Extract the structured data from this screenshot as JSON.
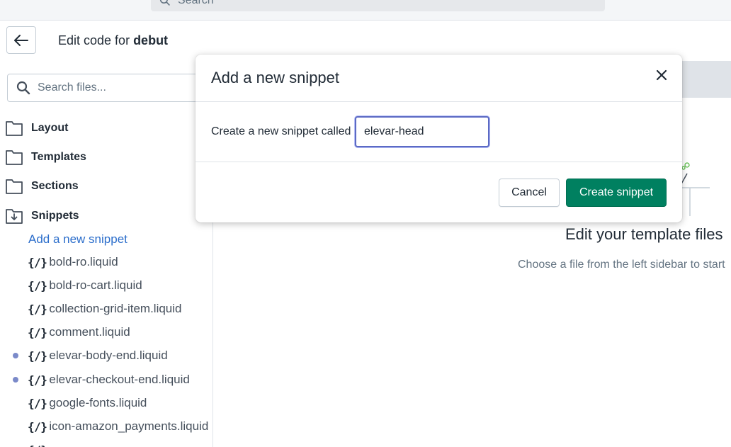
{
  "topbar": {
    "search_placeholder": "Search"
  },
  "header": {
    "title_prefix": "Edit code for ",
    "theme_name": "debut"
  },
  "sidebar": {
    "search_placeholder": "Search files...",
    "folders": [
      {
        "label": "Layout",
        "icon": "folder-icon"
      },
      {
        "label": "Templates",
        "icon": "folder-icon"
      },
      {
        "label": "Sections",
        "icon": "folder-icon"
      },
      {
        "label": "Snippets",
        "icon": "folder-open-icon"
      }
    ],
    "add_snippet_label": "Add a new snippet",
    "file_icon_glyph": "{/}",
    "files": [
      {
        "name": "bold-ro.liquid",
        "modified": false
      },
      {
        "name": "bold-ro-cart.liquid",
        "modified": false
      },
      {
        "name": "collection-grid-item.liquid",
        "modified": false
      },
      {
        "name": "comment.liquid",
        "modified": false
      },
      {
        "name": "elevar-body-end.liquid",
        "modified": true
      },
      {
        "name": "elevar-checkout-end.liquid",
        "modified": true
      },
      {
        "name": "google-fonts.liquid",
        "modified": false
      },
      {
        "name": "icon-amazon_payments.liquid",
        "modified": false
      }
    ]
  },
  "main": {
    "title": "Edit your template files",
    "subtitle": "Choose a file from the left sidebar to start"
  },
  "modal": {
    "title": "Add a new snippet",
    "field_label": "Create a new snippet called",
    "field_value": "elevar-head",
    "cancel_label": "Cancel",
    "create_label": "Create snippet"
  },
  "colors": {
    "primary_green": "#008060",
    "link_blue": "#2c6ecb",
    "modified_dot": "#7b8ac9",
    "focus_ring": "#5c6ac4"
  }
}
